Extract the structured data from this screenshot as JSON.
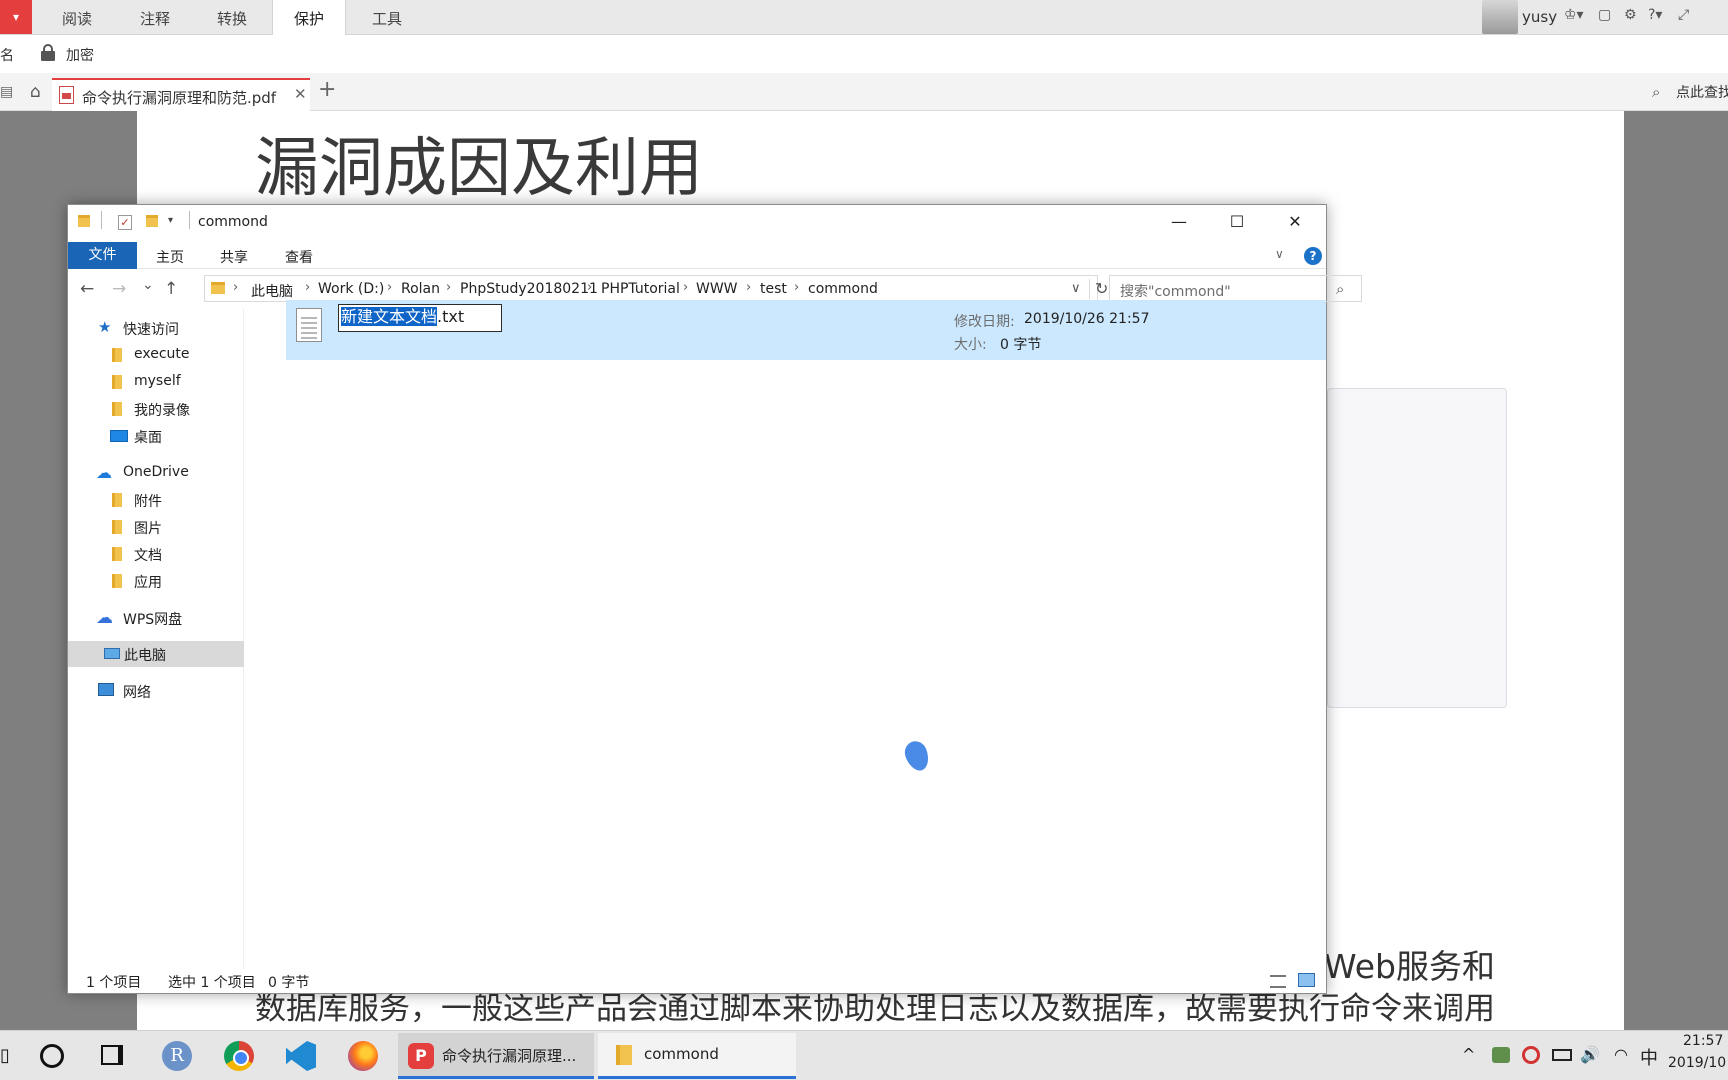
{
  "wps": {
    "logo": "▾",
    "menu_tabs": [
      "阅读",
      "注释",
      "转换",
      "保护",
      "工具"
    ],
    "active_tab": "保护",
    "user": {
      "name": "yusy",
      "badge": "♔▾",
      "icons": [
        "▢",
        "⚙",
        "?▾",
        "⤢"
      ]
    },
    "toolbar": {
      "rename_label": "名",
      "encrypt_label": "加密"
    },
    "doc_tab": {
      "title": "命令执行漏洞原理和防范.pdf",
      "close": "✕",
      "new_tab": "+"
    },
    "search_hint": "点此查找"
  },
  "pdf": {
    "heading": "漏洞成因及利用",
    "line1": "Web服务和",
    "line2": "数据库服务，一般这些产品会通过脚本来协助处理日志以及数据库，故需要执行命令来调用"
  },
  "explorer": {
    "title": "commond",
    "window_buttons": {
      "minimize": "—",
      "maximize": "☐",
      "close": "✕"
    },
    "ribbon": {
      "file": "文件",
      "tabs": [
        "主页",
        "共享",
        "查看"
      ],
      "help": "?"
    },
    "nav": {
      "back": "←",
      "forward": "→",
      "recent": "⌄",
      "up": "↑"
    },
    "breadcrumbs": [
      "此电脑",
      "Work (D:)",
      "Rolan",
      "PhpStudy20180211",
      "PHPTutorial",
      "WWW",
      "test",
      "commond"
    ],
    "breadcrumb_sep": "›",
    "search_placeholder": "搜索\"commond\"",
    "sidebar": {
      "quick_access": "快速访问",
      "quick_items": [
        "execute",
        "myself",
        "我的录像",
        "桌面"
      ],
      "onedrive": "OneDrive",
      "onedrive_items": [
        "附件",
        "图片",
        "文档",
        "应用"
      ],
      "wps_cloud": "WPS网盘",
      "this_pc": "此电脑",
      "network": "网络"
    },
    "file": {
      "name_selected": "新建文本文档",
      "extension": ".txt",
      "date_label": "修改日期:",
      "date_value": "2019/10/26 21:57",
      "size_label": "大小:",
      "size_value": "0 字节"
    },
    "status": {
      "count": "1 个项目",
      "selected": "选中 1 个项目",
      "size": "0 字节"
    }
  },
  "taskbar": {
    "r_app": "R",
    "wps_label": "命令执行漏洞原理...",
    "wps_icon": "P",
    "explorer_label": "commond",
    "tray": {
      "chevron": "^",
      "volume": "🔊",
      "ime": "中",
      "time": "21:57",
      "date": "2019/10"
    }
  },
  "colors": {
    "accent": "#1a65b5",
    "wps_red": "#e53e3e",
    "selection": "#cce8ff"
  }
}
